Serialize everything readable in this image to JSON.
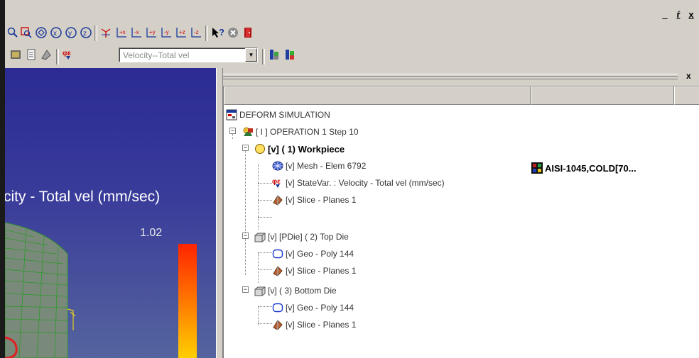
{
  "window_controls": {
    "minimize": "_",
    "restore": "ŕ",
    "close": "x"
  },
  "toolbar2": {
    "velocity_select": {
      "value": "Velocity--Total vel"
    }
  },
  "viewport": {
    "title": "city - Total vel (mm/sec)",
    "max_value": "1.02"
  },
  "panel": {
    "close": "x"
  },
  "tree": {
    "root": "DEFORM SIMULATION",
    "operation": "[ I ] OPERATION 1  Step 10",
    "workpiece": "[v] (  1) Workpiece",
    "workpiece_material": "AISI-1045,COLD[70...",
    "wp_mesh": "[v] Mesh - Elem 6792",
    "wp_statevar": "[v] StateVar. :  Velocity - Total vel (mm/sec)",
    "wp_slice": "[v] Slice - Planes 1",
    "topdie": "[v] [PDie] (  2) Top Die",
    "topdie_geo": "[v] Geo - Poly 144",
    "topdie_slice": "[v] Slice - Planes 1",
    "bottomdie": "[v] (  3) Bottom Die",
    "bottomdie_geo": "[v] Geo - Poly 144",
    "bottomdie_slice": "[v] Slice - Planes 1"
  }
}
